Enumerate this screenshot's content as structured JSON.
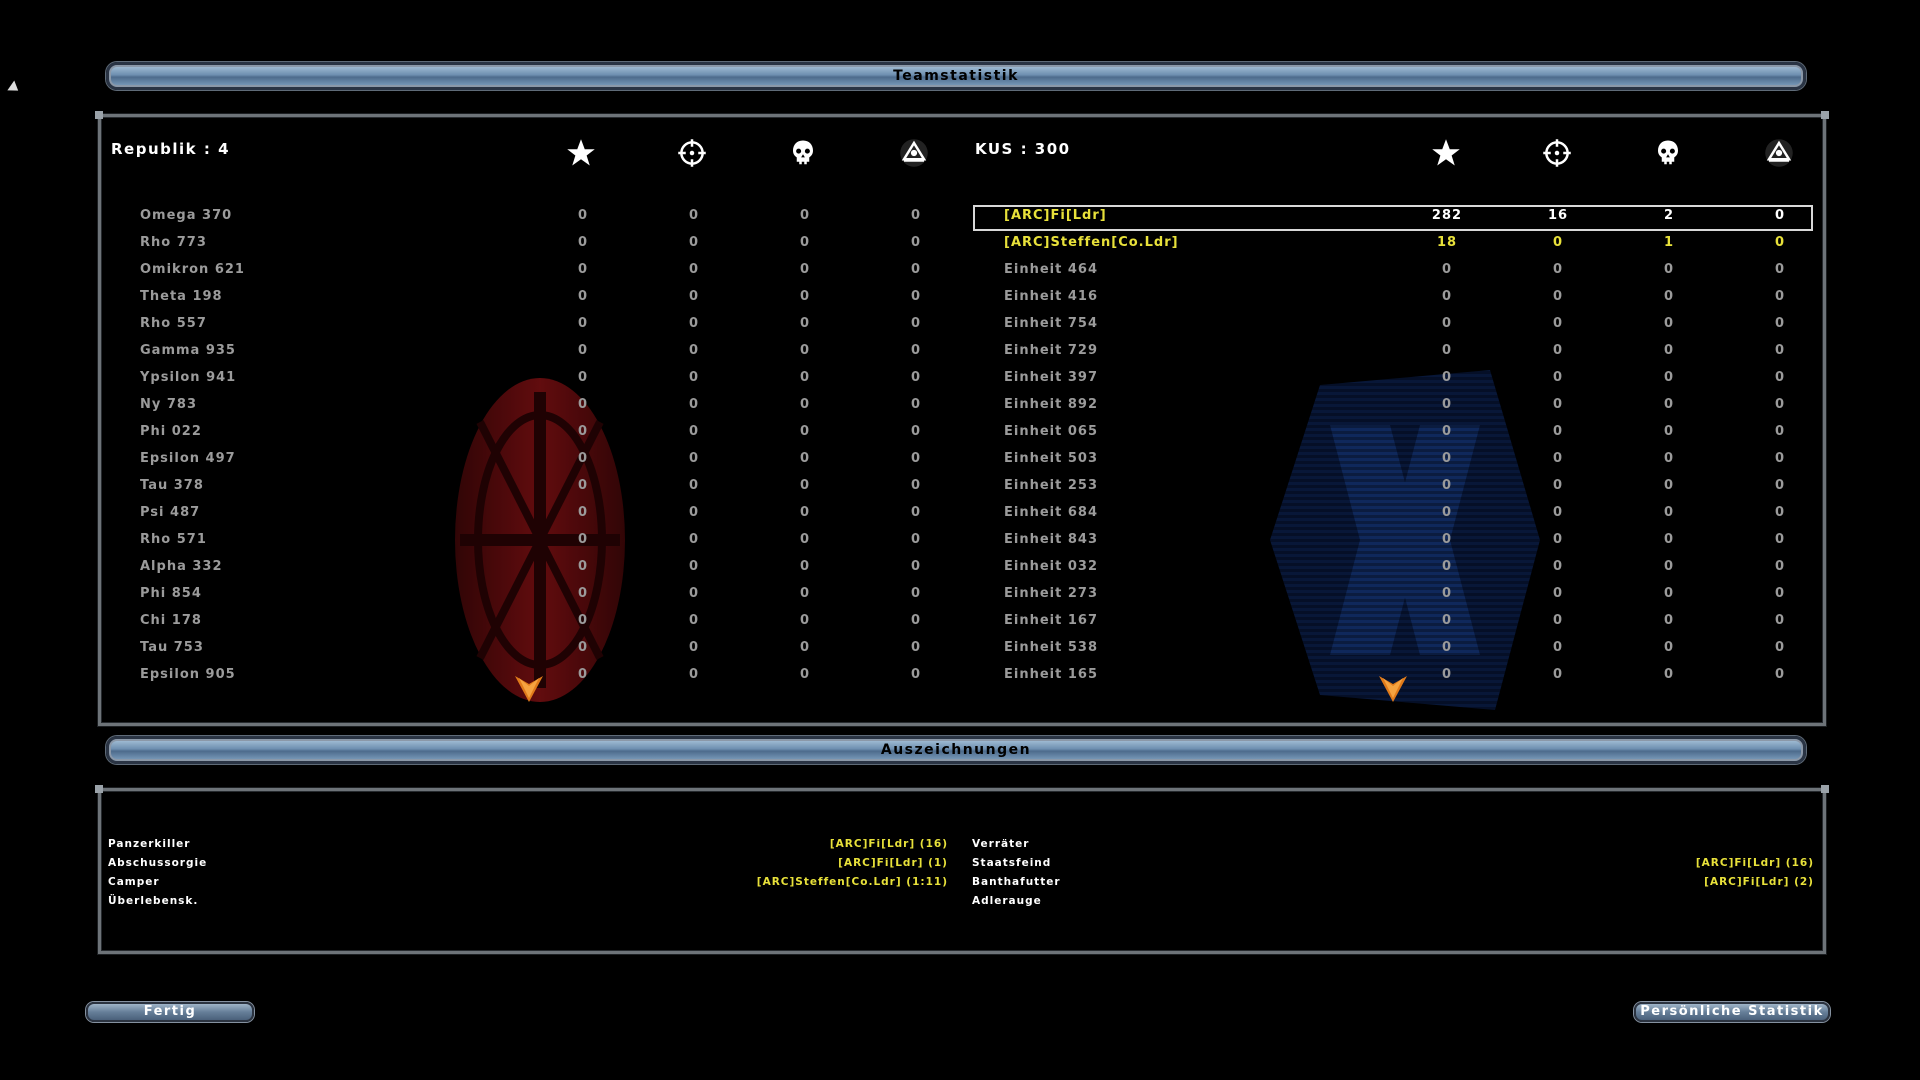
{
  "title": "Teamstatistik",
  "awards_title": "Auszeichnungen",
  "colors": {
    "selected_text": "#e8e13a",
    "default_text": "#9b9b9b",
    "bar_blue": "#6e8fb0",
    "emblem_red": "#7a0f12",
    "emblem_blue": "#13306e"
  },
  "icons": [
    "star-icon",
    "crosshair-icon",
    "skull-icon",
    "vehicle-icon"
  ],
  "republic": {
    "header": "Republik : 4",
    "players": [
      {
        "name": "Omega 370",
        "stats": [
          "0",
          "0",
          "0",
          "0"
        ]
      },
      {
        "name": "Rho 773",
        "stats": [
          "0",
          "0",
          "0",
          "0"
        ]
      },
      {
        "name": "Omikron 621",
        "stats": [
          "0",
          "0",
          "0",
          "0"
        ]
      },
      {
        "name": "Theta 198",
        "stats": [
          "0",
          "0",
          "0",
          "0"
        ]
      },
      {
        "name": "Rho 557",
        "stats": [
          "0",
          "0",
          "0",
          "0"
        ]
      },
      {
        "name": "Gamma 935",
        "stats": [
          "0",
          "0",
          "0",
          "0"
        ]
      },
      {
        "name": "Ypsilon 941",
        "stats": [
          "0",
          "0",
          "0",
          "0"
        ]
      },
      {
        "name": "Ny 783",
        "stats": [
          "0",
          "0",
          "0",
          "0"
        ]
      },
      {
        "name": "Phi 022",
        "stats": [
          "0",
          "0",
          "0",
          "0"
        ]
      },
      {
        "name": "Epsilon 497",
        "stats": [
          "0",
          "0",
          "0",
          "0"
        ]
      },
      {
        "name": "Tau 378",
        "stats": [
          "0",
          "0",
          "0",
          "0"
        ]
      },
      {
        "name": "Psi 487",
        "stats": [
          "0",
          "0",
          "0",
          "0"
        ]
      },
      {
        "name": "Rho 571",
        "stats": [
          "0",
          "0",
          "0",
          "0"
        ]
      },
      {
        "name": "Alpha 332",
        "stats": [
          "0",
          "0",
          "0",
          "0"
        ]
      },
      {
        "name": "Phi 854",
        "stats": [
          "0",
          "0",
          "0",
          "0"
        ]
      },
      {
        "name": "Chi 178",
        "stats": [
          "0",
          "0",
          "0",
          "0"
        ]
      },
      {
        "name": "Tau 753",
        "stats": [
          "0",
          "0",
          "0",
          "0"
        ]
      },
      {
        "name": "Epsilon 905",
        "stats": [
          "0",
          "0",
          "0",
          "0"
        ]
      }
    ]
  },
  "kus": {
    "header": "KUS : 300",
    "players": [
      {
        "name": "[ARC]Fi[Ldr]",
        "stats": [
          "282",
          "16",
          "2",
          "0"
        ],
        "highlight": "yellow-white",
        "selected": true
      },
      {
        "name": "[ARC]Steffen[Co.Ldr]",
        "stats": [
          "18",
          "0",
          "1",
          "0"
        ],
        "highlight": "yellow"
      },
      {
        "name": "Einheit 464",
        "stats": [
          "0",
          "0",
          "0",
          "0"
        ]
      },
      {
        "name": "Einheit 416",
        "stats": [
          "0",
          "0",
          "0",
          "0"
        ]
      },
      {
        "name": "Einheit 754",
        "stats": [
          "0",
          "0",
          "0",
          "0"
        ]
      },
      {
        "name": "Einheit 729",
        "stats": [
          "0",
          "0",
          "0",
          "0"
        ]
      },
      {
        "name": "Einheit 397",
        "stats": [
          "0",
          "0",
          "0",
          "0"
        ]
      },
      {
        "name": "Einheit 892",
        "stats": [
          "0",
          "0",
          "0",
          "0"
        ]
      },
      {
        "name": "Einheit 065",
        "stats": [
          "0",
          "0",
          "0",
          "0"
        ]
      },
      {
        "name": "Einheit 503",
        "stats": [
          "0",
          "0",
          "0",
          "0"
        ]
      },
      {
        "name": "Einheit 253",
        "stats": [
          "0",
          "0",
          "0",
          "0"
        ]
      },
      {
        "name": "Einheit 684",
        "stats": [
          "0",
          "0",
          "0",
          "0"
        ]
      },
      {
        "name": "Einheit 843",
        "stats": [
          "0",
          "0",
          "0",
          "0"
        ]
      },
      {
        "name": "Einheit 032",
        "stats": [
          "0",
          "0",
          "0",
          "0"
        ]
      },
      {
        "name": "Einheit 273",
        "stats": [
          "0",
          "0",
          "0",
          "0"
        ]
      },
      {
        "name": "Einheit 167",
        "stats": [
          "0",
          "0",
          "0",
          "0"
        ]
      },
      {
        "name": "Einheit 538",
        "stats": [
          "0",
          "0",
          "0",
          "0"
        ]
      },
      {
        "name": "Einheit 165",
        "stats": [
          "0",
          "0",
          "0",
          "0"
        ]
      }
    ]
  },
  "awards_left": [
    {
      "label": "Panzerkiller",
      "value": "[ARC]Fi[Ldr] (16)"
    },
    {
      "label": "Abschussorgie",
      "value": "[ARC]Fi[Ldr] (1)"
    },
    {
      "label": "Camper",
      "value": "[ARC]Steffen[Co.Ldr] (1:11)"
    },
    {
      "label": "Überlebensk.",
      "value": ""
    }
  ],
  "awards_right": [
    {
      "label": "Verräter",
      "value": ""
    },
    {
      "label": "Staatsfeind",
      "value": "[ARC]Fi[Ldr] (16)"
    },
    {
      "label": "Banthafutter",
      "value": "[ARC]Fi[Ldr] (2)"
    },
    {
      "label": "Adlerauge",
      "value": ""
    }
  ],
  "buttons": {
    "done": "Fertig",
    "personal": "Persönliche Statistik"
  }
}
